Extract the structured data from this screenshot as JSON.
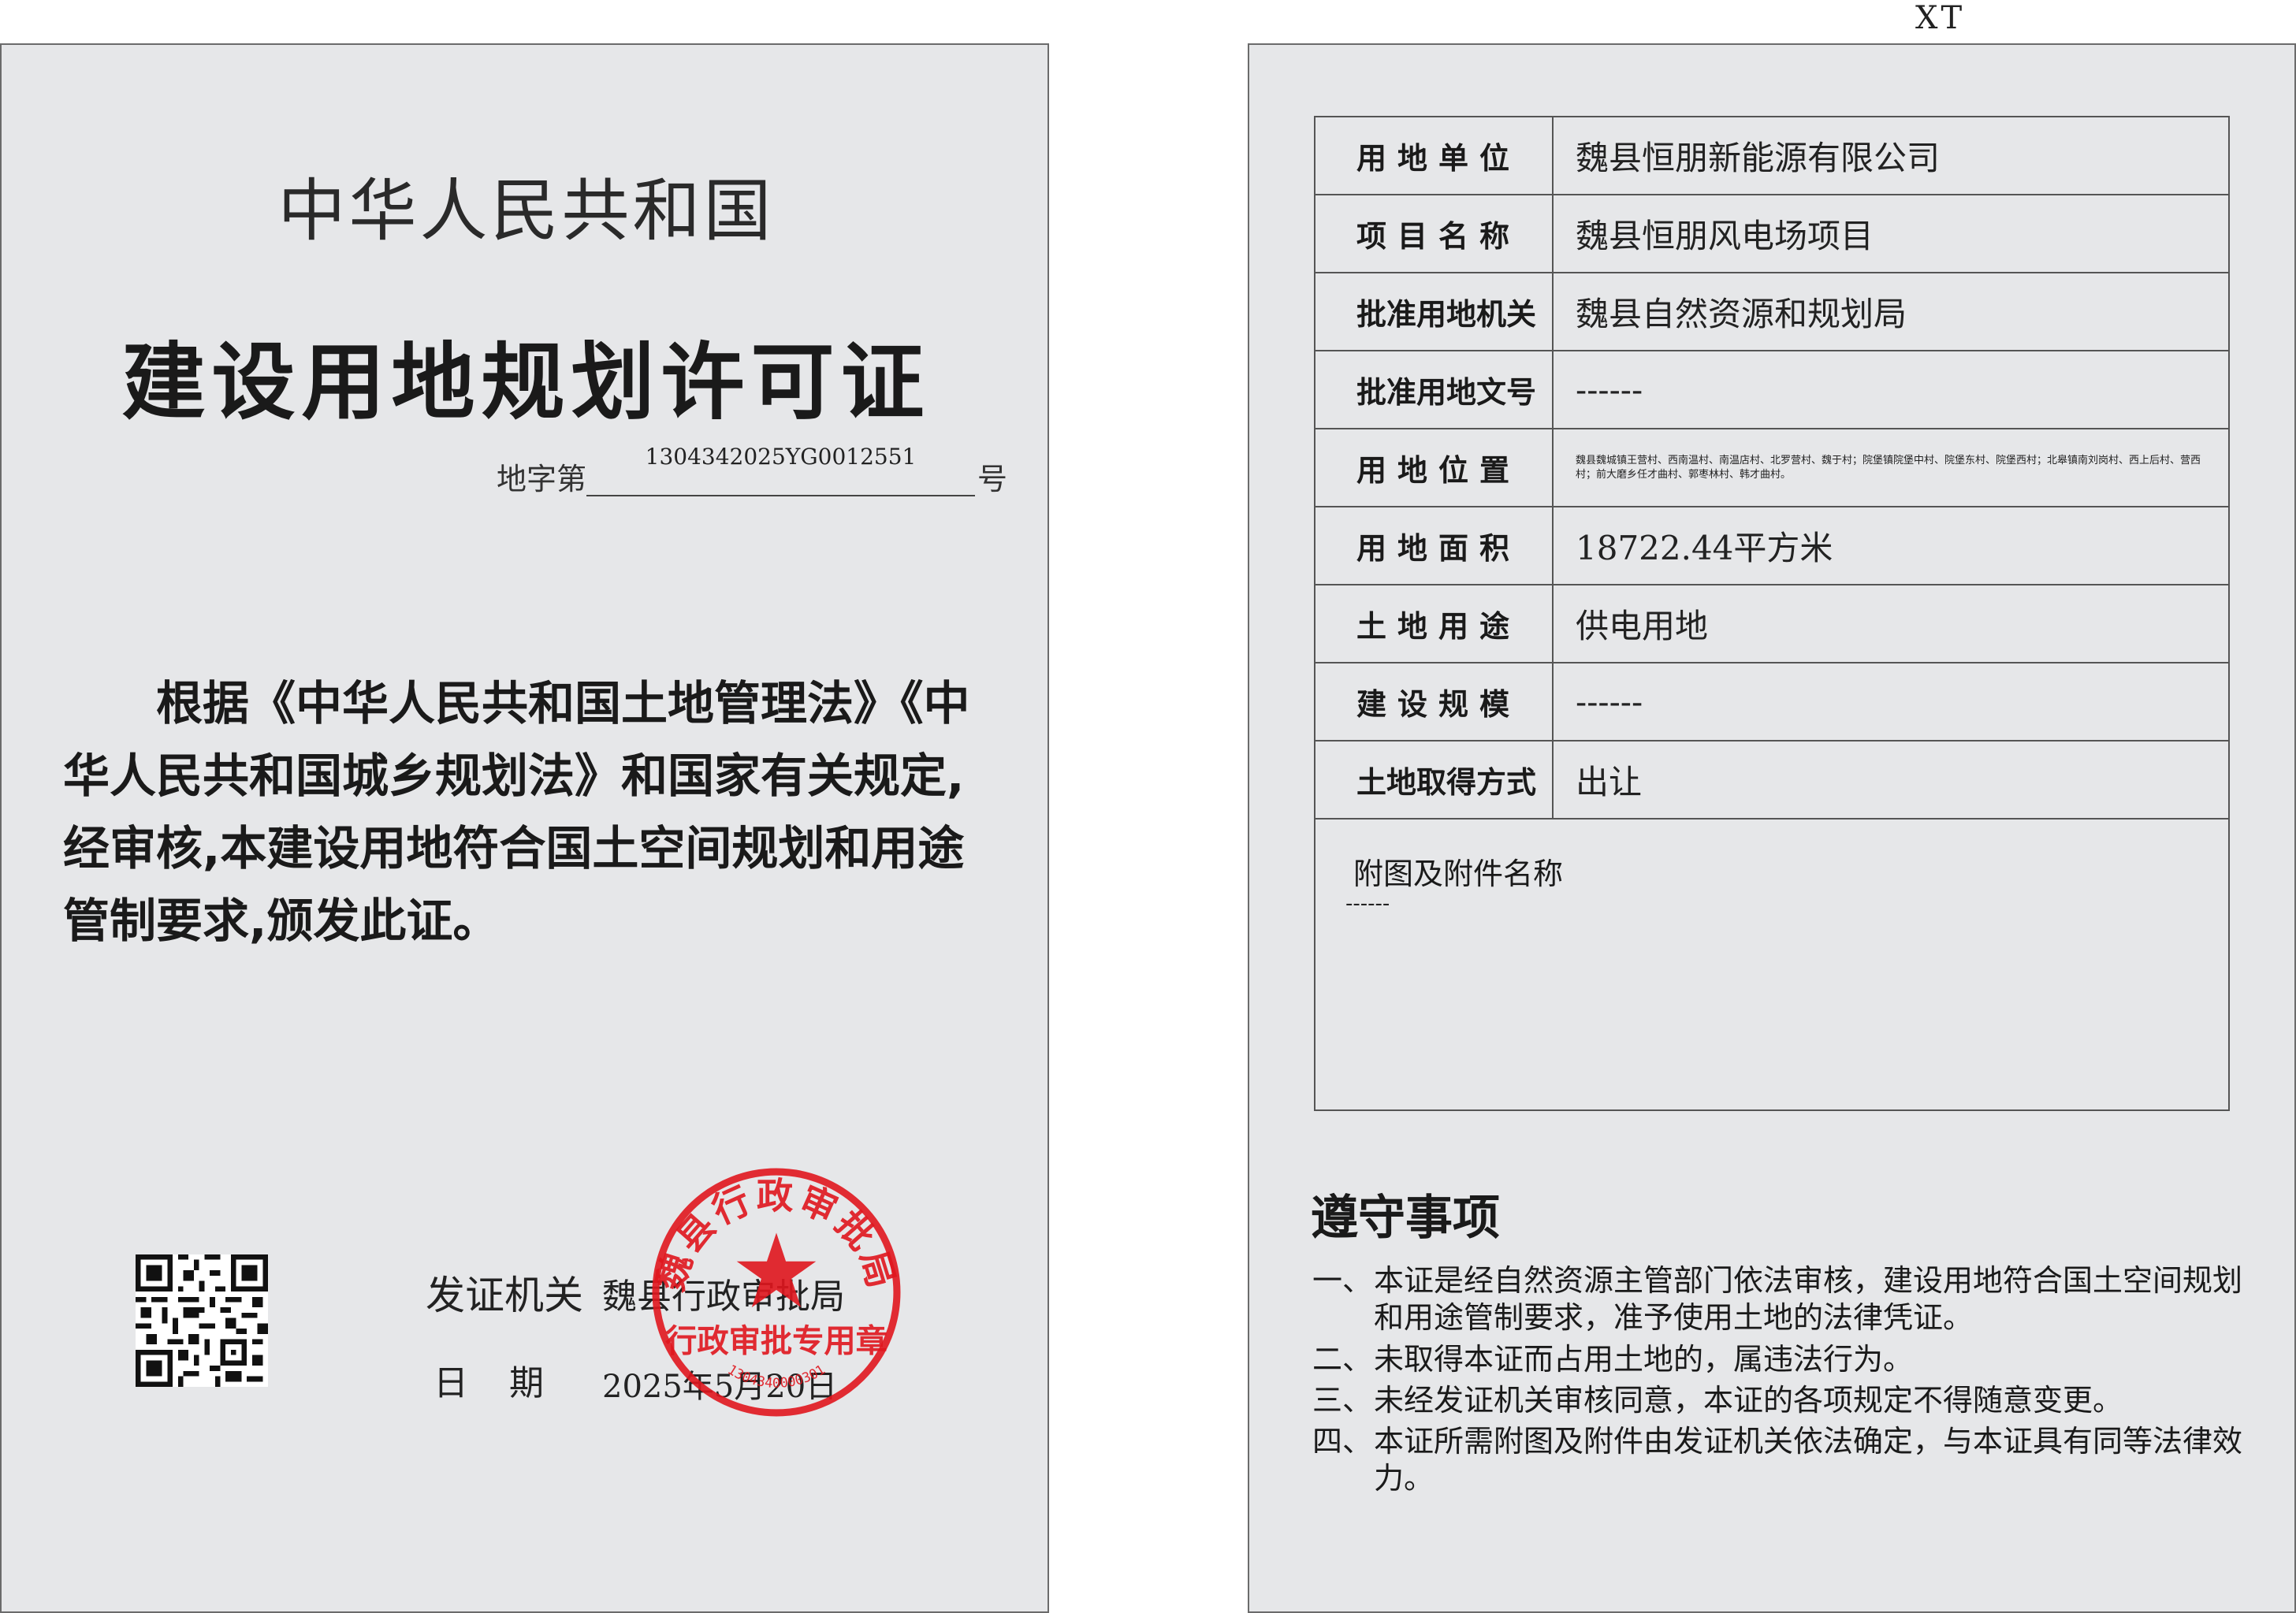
{
  "left": {
    "country": "中华人民共和国",
    "title": "建设用地规划许可证",
    "cert_no_prefix": "地字第",
    "cert_no": "1304342025YG0012551",
    "cert_no_suffix": "号",
    "preamble_lines": [
      "根据《中华人民共和国土地管理法》《中",
      "华人民共和国城乡规划法》和国家有关规定,",
      "经审核,本建设用地符合国土空间规划和用途",
      "管制要求,颁发此证。"
    ],
    "issuer_label": "发证机关",
    "issuer": "魏县行政审批局",
    "date_label": "日期",
    "date": "2025年5月20日",
    "seal": {
      "text_top": "魏县行政审批局",
      "text_bottom": "行政审批专用章",
      "serial": "1304340000301",
      "color": "#e0161e"
    }
  },
  "right": {
    "top_mark": "XT",
    "rows": [
      {
        "label": "用地单位",
        "value": "魏县恒朋新能源有限公司"
      },
      {
        "label": "项目名称",
        "value": "魏县恒朋风电场项目"
      },
      {
        "label": "批准用地机关",
        "value": "魏县自然资源和规划局"
      },
      {
        "label": "批准用地文号",
        "value": "------"
      },
      {
        "label": "用地位置",
        "value": "魏县魏城镇王营村、西南温村、南温店村、北罗营村、魏于村；院堡镇院堡中村、院堡东村、院堡西村；北皋镇南刘岗村、西上后村、营西村；前大磨乡任才曲村、郭枣林村、韩才曲村。"
      },
      {
        "label": "用地面积",
        "value": "18722.44平方米"
      },
      {
        "label": "土地用途",
        "value": "供电用地"
      },
      {
        "label": "建设规模",
        "value": "------"
      },
      {
        "label": "土地取得方式",
        "value": "出让"
      }
    ],
    "attachments_label": "附图及附件名称",
    "attachments_value": "------",
    "rules_title": "遵守事项",
    "rules": [
      {
        "num": "一、",
        "line1": "本证是经自然资源主管部门依法审核，建设用地符合国土空间规划",
        "line2": "和用途管制要求，准予使用土地的法律凭证。"
      },
      {
        "num": "二、",
        "line1": "未取得本证而占用土地的，属违法行为。",
        "line2": ""
      },
      {
        "num": "三、",
        "line1": "未经发证机关审核同意，本证的各项规定不得随意变更。",
        "line2": ""
      },
      {
        "num": "四、",
        "line1": "本证所需附图及附件由发证机关依法确定，与本证具有同等法律效",
        "line2": "力。"
      }
    ]
  }
}
